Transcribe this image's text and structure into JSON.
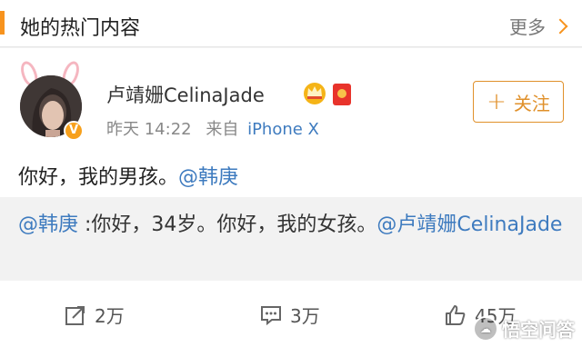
{
  "header": {
    "title": "她的热门内容",
    "more_label": "更多"
  },
  "post": {
    "username": "卢靖姗CelinaJade",
    "time": "昨天 14:22",
    "source_prefix": "来自",
    "device": "iPhone X",
    "follow_label": "关注",
    "content_text": "你好，我的男孩。",
    "content_mention": "@韩庚",
    "repost": {
      "mention_author": "@韩庚",
      "text": " :你好，34岁。你好，我的女孩。",
      "mention_target": "@卢靖姗CelinaJade"
    },
    "actions": {
      "share_count": "2万",
      "comment_count": "3万",
      "like_count": "45万"
    }
  },
  "watermark": {
    "text": "悟空问答"
  },
  "colors": {
    "accent": "#f7931e",
    "link": "#3e7bbf",
    "follow": "#e0902a"
  }
}
